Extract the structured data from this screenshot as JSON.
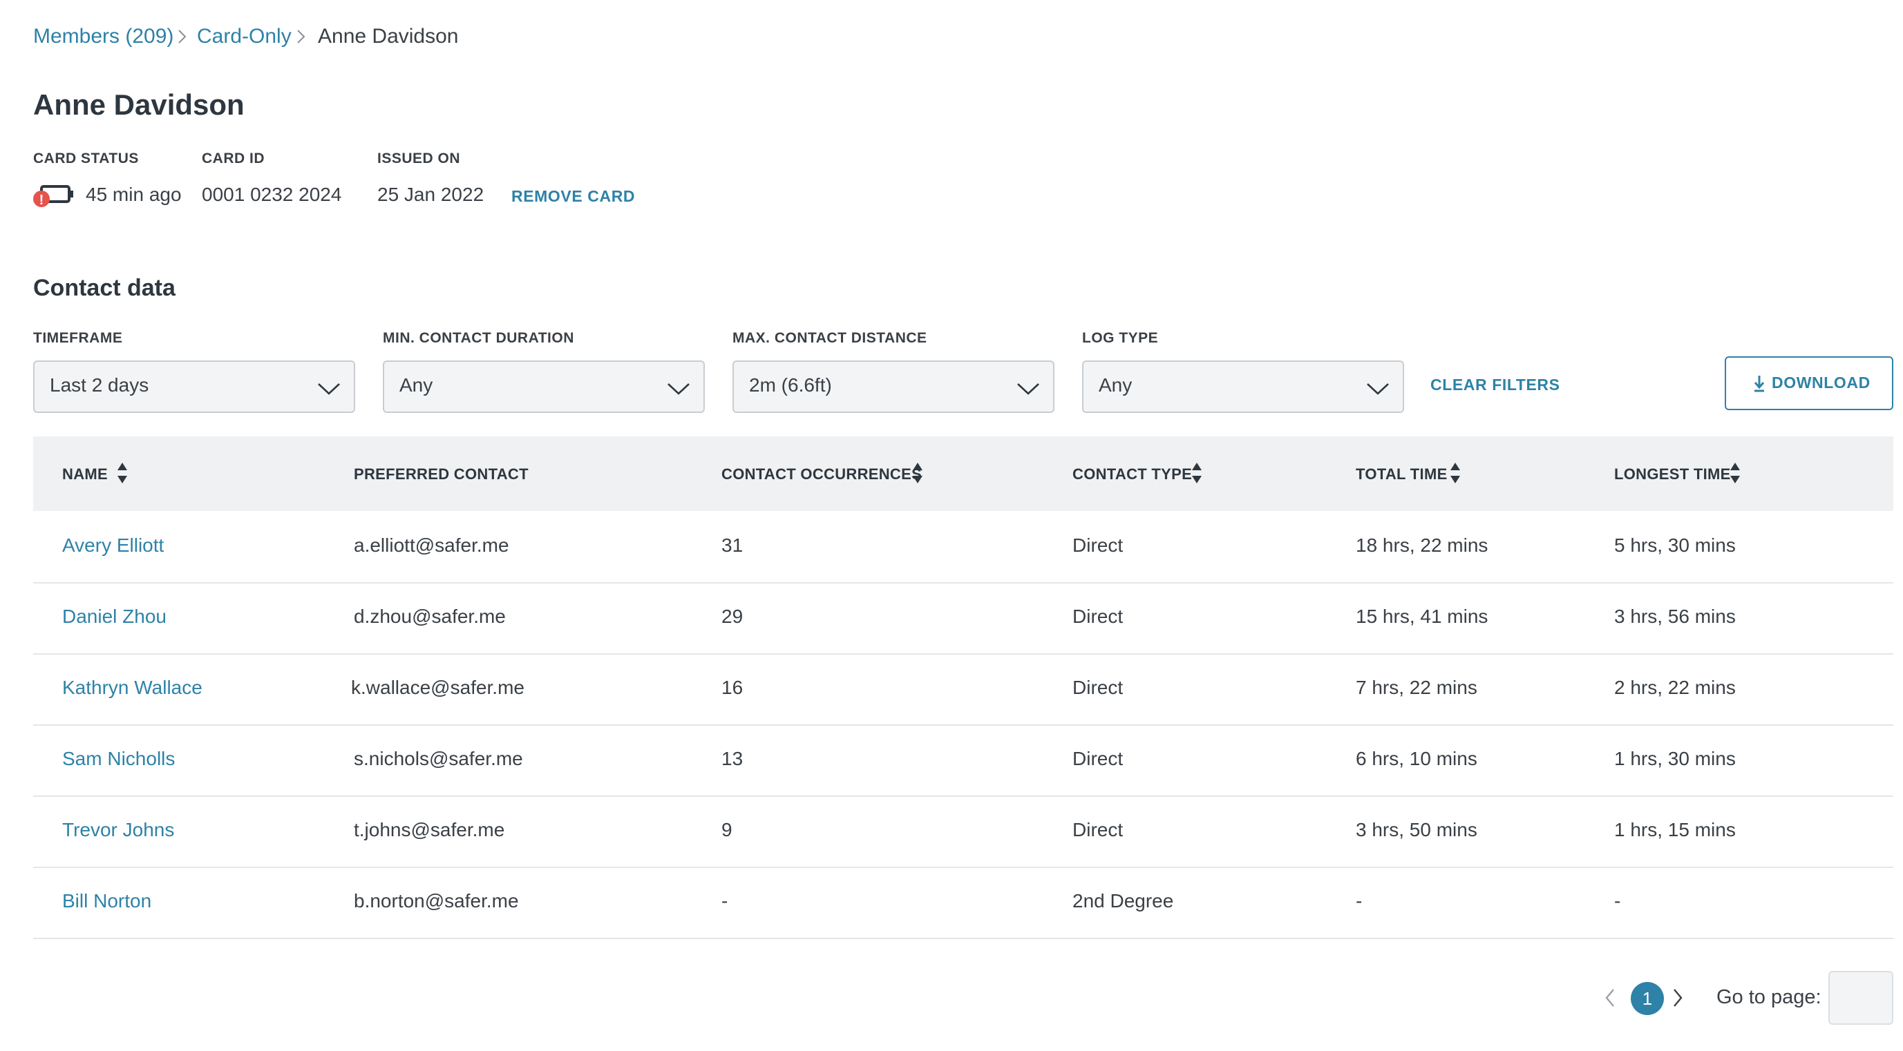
{
  "breadcrumb": {
    "items": [
      {
        "label": "Members (209)"
      },
      {
        "label": "Card-Only"
      },
      {
        "label": "Anne Davidson"
      }
    ]
  },
  "member": {
    "name": "Anne Davidson",
    "card_status_label": "CARD STATUS",
    "card_status_value": "45 min ago",
    "card_id_label": "CARD ID",
    "card_id_value": "0001 0232 2024",
    "issued_label": "ISSUED ON",
    "issued_value": "25 Jan 2022",
    "remove_card_label": "REMOVE CARD",
    "battery_alert": "!"
  },
  "contact": {
    "section_title": "Contact data",
    "filters": {
      "timeframe": {
        "label": "TIMEFRAME",
        "value": "Last 2 days"
      },
      "min_duration": {
        "label": "MIN. CONTACT DURATION",
        "value": "Any"
      },
      "max_distance": {
        "label": "MAX. CONTACT DISTANCE",
        "value": "2m (6.6ft)"
      },
      "log_type": {
        "label": "LOG TYPE",
        "value": "Any"
      }
    },
    "clear_filters_label": "CLEAR FILTERS",
    "download_label": "DOWNLOAD",
    "columns": {
      "name": "NAME",
      "preferred": "PREFERRED CONTACT",
      "occurrences": "CONTACT OCCURRENCES",
      "type": "CONTACT TYPE",
      "total": "TOTAL TIME",
      "longest": "LONGEST TIME"
    },
    "rows": [
      {
        "name": "Avery Elliott",
        "preferred": "a.elliott@safer.me",
        "occurrences": "31",
        "type": "Direct",
        "total": "18 hrs, 22 mins",
        "longest": "5 hrs, 30 mins"
      },
      {
        "name": "Daniel Zhou",
        "preferred": "d.zhou@safer.me",
        "occurrences": "29",
        "type": "Direct",
        "total": "15 hrs, 41 mins",
        "longest": "3 hrs, 56 mins"
      },
      {
        "name": "Kathryn Wallace",
        "preferred": "k.wallace@safer.me",
        "occurrences": "16",
        "type": "Direct",
        "total": "7 hrs, 22 mins",
        "longest": "2 hrs, 22 mins"
      },
      {
        "name": "Sam Nicholls",
        "preferred": "s.nichols@safer.me",
        "occurrences": "13",
        "type": "Direct",
        "total": "6 hrs, 10 mins",
        "longest": "1 hrs, 30 mins"
      },
      {
        "name": "Trevor Johns",
        "preferred": "t.johns@safer.me",
        "occurrences": "9",
        "type": "Direct",
        "total": "3 hrs, 50 mins",
        "longest": "1 hrs, 15 mins"
      },
      {
        "name": "Bill Norton",
        "preferred": "b.norton@safer.me",
        "occurrences": "-",
        "type": "2nd Degree",
        "total": "-",
        "longest": "-"
      }
    ]
  },
  "pagination": {
    "current_page": "1",
    "goto_label": "Go to page:",
    "goto_value": ""
  },
  "colors": {
    "accent": "#2e82a7",
    "alert": "#e5534b",
    "text": "#3a4046",
    "header_bg": "#f0f1f2"
  },
  "icons": {
    "breadcrumb_separator": "chevron-right-icon",
    "card_status": "battery-low-icon",
    "select": "chevron-down-icon",
    "download": "download-icon",
    "sort": "sort-icon",
    "pagination_prev": "chevron-left-icon",
    "pagination_next": "chevron-right-icon"
  }
}
